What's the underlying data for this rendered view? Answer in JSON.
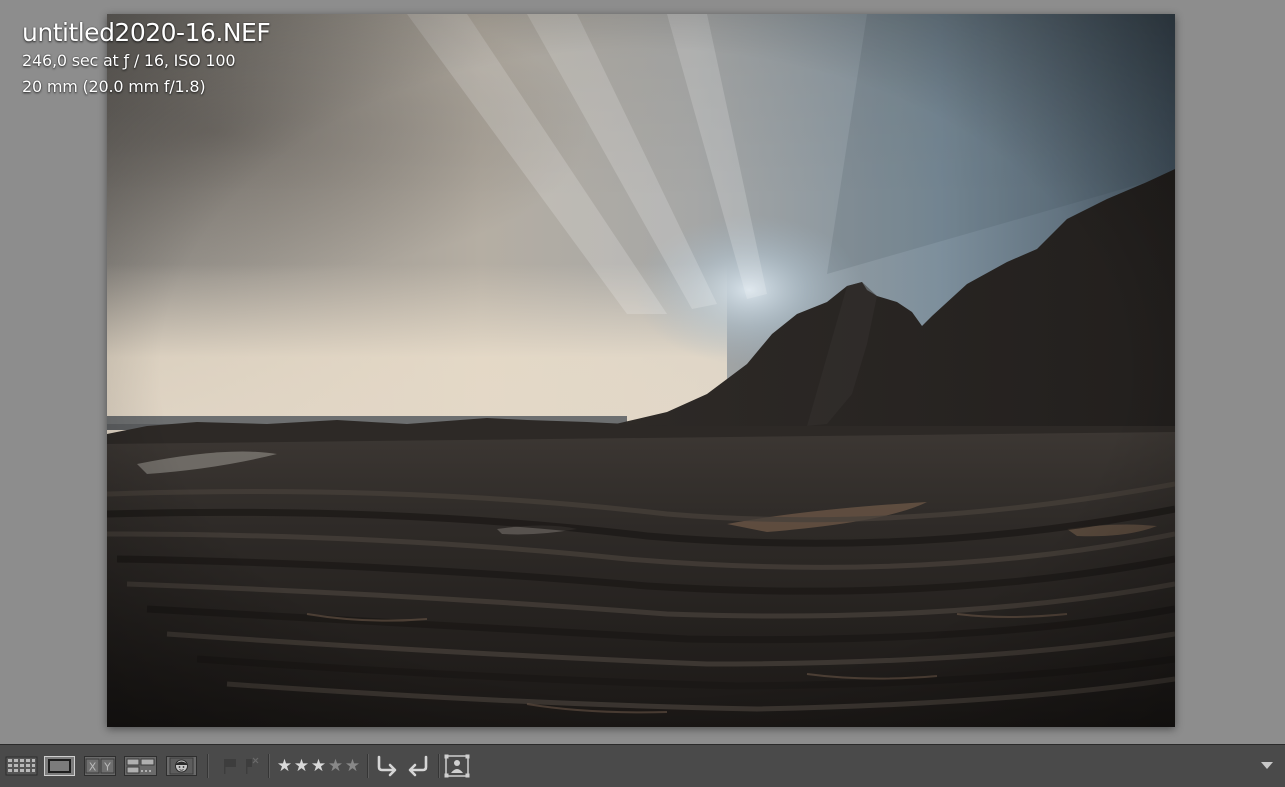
{
  "photo": {
    "filename": "untitled2020-16.NEF",
    "exposure_line": "246,0 sec at ƒ / 16, ISO 100",
    "lens_line": "20 mm (20.0 mm f/1.8)"
  },
  "toolbar": {
    "view_modes": [
      {
        "name": "Grid",
        "icon": "grid-icon",
        "active": false
      },
      {
        "name": "Loupe",
        "icon": "loupe-icon",
        "active": true
      },
      {
        "name": "Compare",
        "icon": "compare-icon",
        "label": "XY",
        "active": false
      },
      {
        "name": "Survey",
        "icon": "survey-icon",
        "active": false
      },
      {
        "name": "People",
        "icon": "people-icon",
        "active": false
      }
    ],
    "compare_label": "XY",
    "flags": {
      "picked": false,
      "rejected": false
    },
    "rating": 3,
    "rating_max": 5,
    "rotate_icons": [
      "rotate-left-icon",
      "rotate-right-icon"
    ],
    "crop_icon": "crop-overlay-icon"
  },
  "colors": {
    "background": "#8d8d8d",
    "toolbar": "#4a4a4a",
    "star_on": "#d9d9d9",
    "star_off": "#888888"
  }
}
